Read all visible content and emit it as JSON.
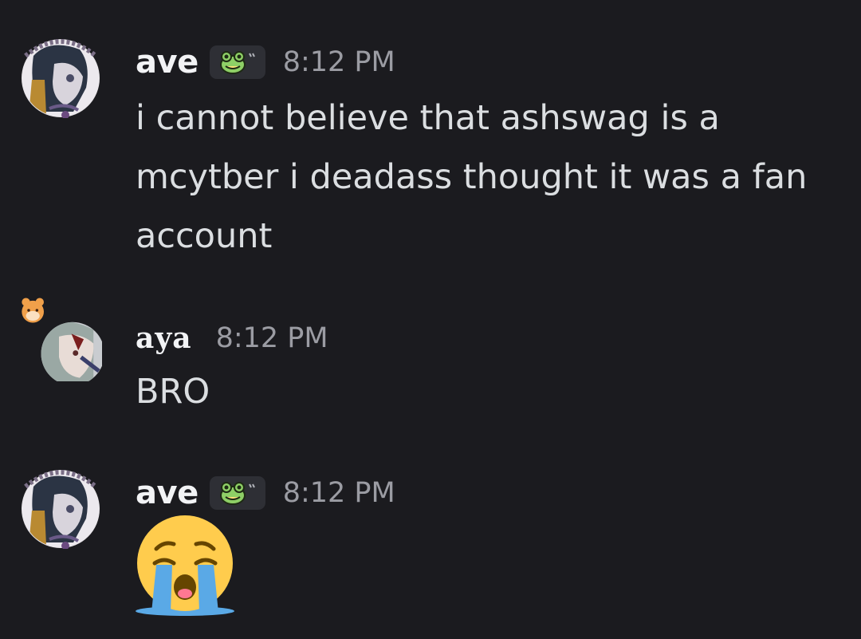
{
  "messages": [
    {
      "username": "ave",
      "badge_icon": "frog-icon",
      "timestamp": "8:12 PM",
      "lines": [
        "i cannot believe that ashswag is a",
        "mcytber i deadass thought it was a fan",
        "account"
      ]
    },
    {
      "username": "aya",
      "timestamp": "8:12 PM",
      "text": "BRO"
    },
    {
      "username": "ave",
      "badge_icon": "frog-icon",
      "timestamp": "8:12 PM",
      "emoji": "loudly-crying-face"
    }
  ],
  "colors": {
    "background": "#1b1b1f",
    "username": "#f2f3f5",
    "timestamp": "#9b9ca3",
    "message_text": "#dbdee1",
    "badge_bg": "#2e2f35"
  }
}
